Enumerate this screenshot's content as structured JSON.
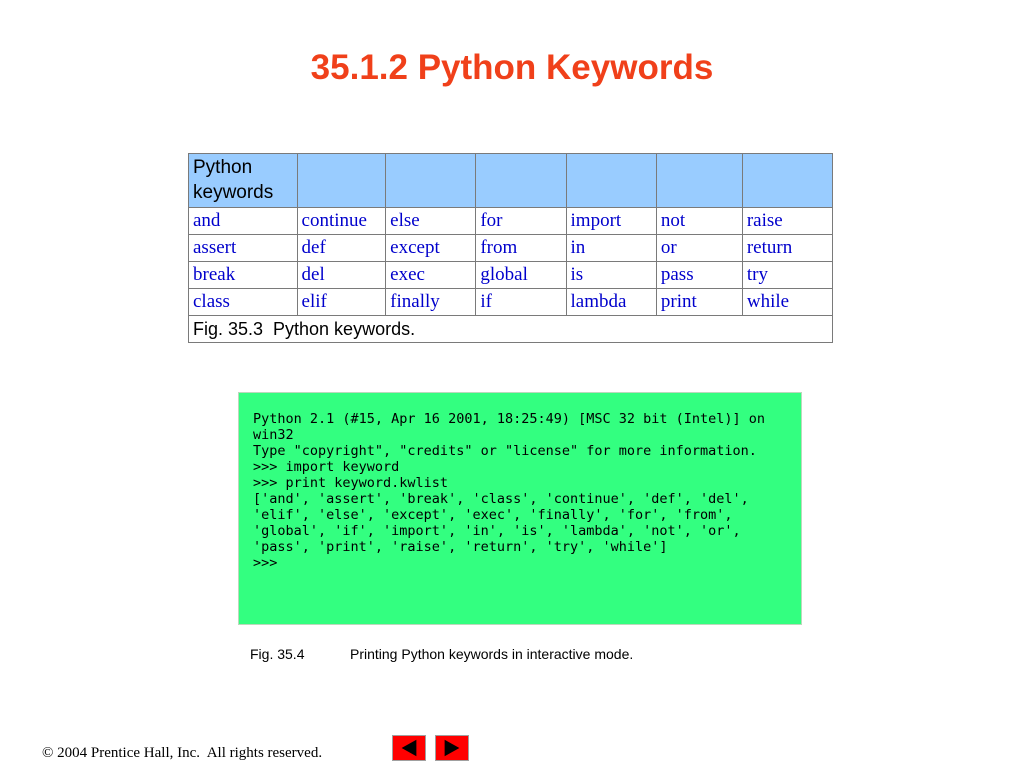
{
  "slide": {
    "title": "35.1.2 Python Keywords"
  },
  "keyword_table": {
    "header": [
      "Python keywords",
      "",
      "",
      "",
      "",
      "",
      ""
    ],
    "rows": [
      [
        "and",
        "continue",
        "else",
        "for",
        "import",
        "not",
        "raise"
      ],
      [
        "assert",
        "def",
        "except",
        "from",
        "in",
        "or",
        "return"
      ],
      [
        "break",
        "del",
        "exec",
        "global",
        "is",
        "pass",
        "try"
      ],
      [
        "class",
        "elif",
        "finally",
        "if",
        "lambda",
        "print",
        "while"
      ]
    ],
    "caption": "Fig. 35.3\tPython keywords."
  },
  "console": {
    "text": "Python 2.1 (#15, Apr 16 2001, 18:25:49) [MSC 32 bit (Intel)] on win32\nType \"copyright\", \"credits\" or \"license\" for more information.\n>>> import keyword\n>>> print keyword.kwlist\n['and', 'assert', 'break', 'class', 'continue', 'def', 'del', 'elif', 'else', 'except', 'exec', 'finally', 'for', 'from', 'global', 'if', 'import', 'in', 'is', 'lambda', 'not', 'or', 'pass', 'print', 'raise', 'return', 'try', 'while']\n>>>"
  },
  "figure_caption": {
    "number": "Fig. 35.4",
    "text": "Printing Python keywords in interactive mode."
  },
  "footer": {
    "copyright": "© 2004 Prentice Hall, Inc.  All rights reserved."
  },
  "nav": {
    "prev_icon": "arrow-left-icon",
    "next_icon": "arrow-right-icon",
    "color": "#ff0000"
  },
  "colors": {
    "title": "#f0401a",
    "table_header_bg": "#99ccff",
    "keyword_text": "#0000cc",
    "console_bg": "#33ff80"
  }
}
